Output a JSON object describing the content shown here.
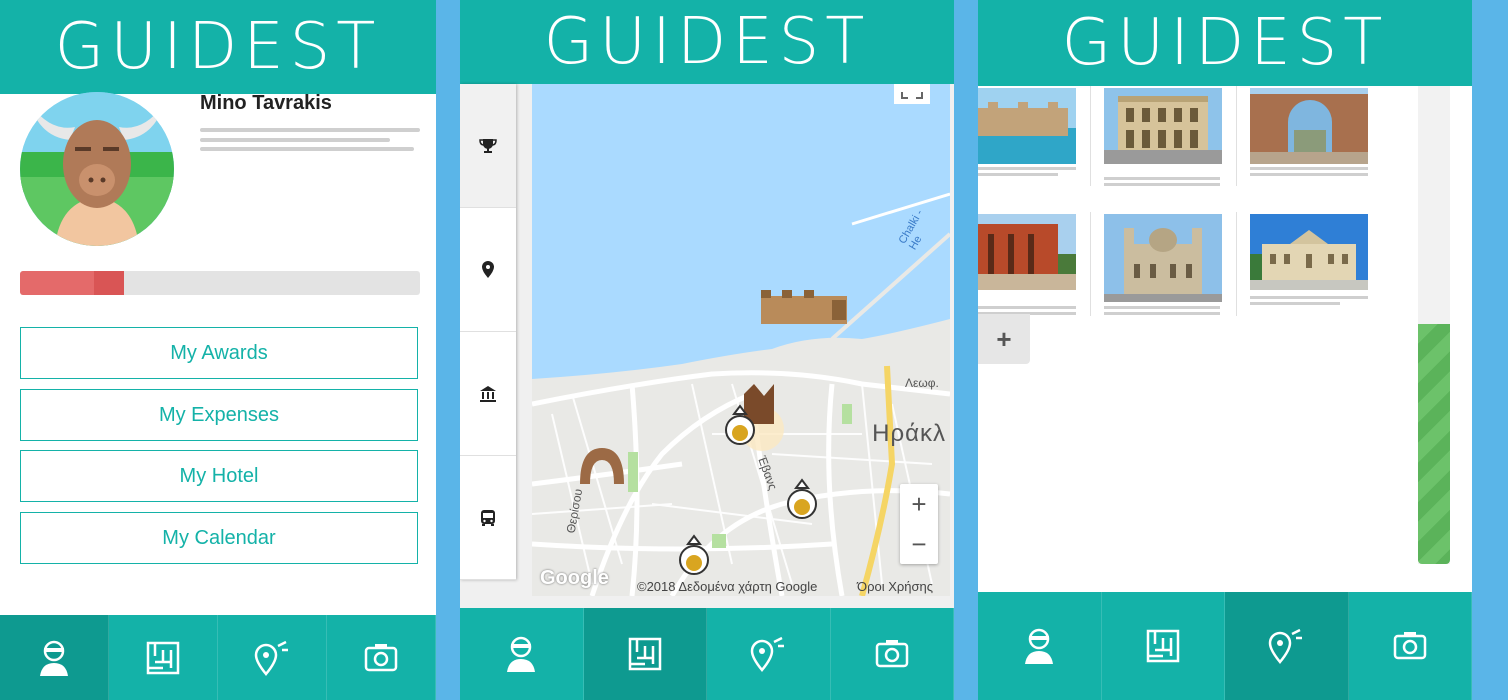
{
  "app": {
    "logo_text": "GUIDEST"
  },
  "profile": {
    "user_name": "Mino Tavrakis",
    "progress_percent": 26,
    "menu": [
      "My Awards",
      "My Expenses",
      "My Hotel",
      "My Calendar"
    ]
  },
  "map": {
    "attribution": "©2018 Δεδομένα χάρτη Google",
    "terms": "Όροι Χρήσης",
    "google": "Google",
    "city_label": "Ηράκλ",
    "street_labels": [
      "Λεωφ.",
      "Έβανς",
      "Θερίσου",
      "Chalki - He"
    ],
    "zoom_in": "+",
    "zoom_out": "−",
    "side_tabs": [
      "trophy-icon",
      "pin-icon",
      "museum-icon",
      "bus-icon"
    ]
  },
  "gallery": {
    "add_label": "+",
    "items": [
      {
        "name": "venetian-fortress",
        "color": "#3aa9c9"
      },
      {
        "name": "loggia",
        "color": "#c9b080"
      },
      {
        "name": "bembo-gate",
        "color": "#a06a4a"
      },
      {
        "name": "knossos",
        "color": "#a85030"
      },
      {
        "name": "agios-minas-cathedral",
        "color": "#b8a890"
      },
      {
        "name": "white-building",
        "color": "#d8c89c"
      }
    ]
  },
  "nav": {
    "items": [
      "profile-icon",
      "maze-icon",
      "route-icon",
      "camera-icon"
    ],
    "active": [
      0,
      1,
      2
    ]
  },
  "colors": {
    "teal": "#14b2a8",
    "teal_dark": "#0e9a90",
    "progress": "#e46a6a",
    "background": "#5ab5e8"
  }
}
